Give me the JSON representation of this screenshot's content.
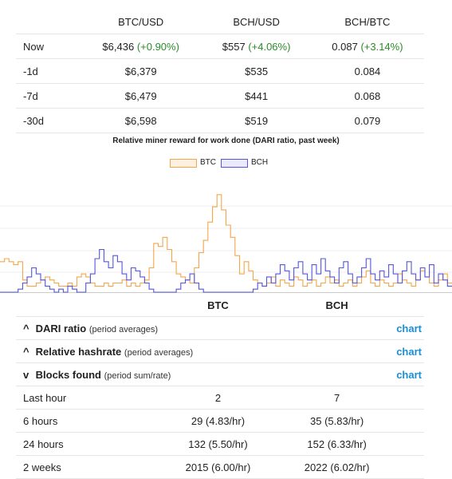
{
  "prices": {
    "columns": [
      "BTC/USD",
      "BCH/USD",
      "BCH/BTC"
    ],
    "rows": [
      {
        "label": "Now",
        "cells": [
          {
            "value": "$6,436",
            "change": "(+0.90%)"
          },
          {
            "value": "$557",
            "change": "(+4.06%)"
          },
          {
            "value": "0.087",
            "change": "(+3.14%)"
          }
        ]
      },
      {
        "label": "-1d",
        "cells": [
          {
            "value": "$6,379"
          },
          {
            "value": "$535"
          },
          {
            "value": "0.084"
          }
        ]
      },
      {
        "label": "-7d",
        "cells": [
          {
            "value": "$6,479"
          },
          {
            "value": "$441"
          },
          {
            "value": "0.068"
          }
        ]
      },
      {
        "label": "-30d",
        "cells": [
          {
            "value": "$6,598"
          },
          {
            "value": "$519"
          },
          {
            "value": "0.079"
          }
        ]
      }
    ]
  },
  "chart_data": {
    "type": "line",
    "title": "Relative miner reward for work done (DARI ratio, past week)",
    "legend_position": "top-center",
    "grid": true,
    "series": [
      {
        "name": "BTC",
        "color": "#f5a54a",
        "values": [
          1.0,
          1.1,
          1.0,
          0.9,
          1.0,
          0.4,
          0.2,
          0.2,
          0.3,
          0.4,
          0.5,
          0.4,
          0.3,
          0.2,
          0.2,
          0.3,
          0.2,
          0.5,
          0.6,
          0.5,
          0.3,
          0.2,
          0.2,
          0.3,
          0.2,
          0.3,
          0.3,
          0.4,
          0.2,
          0.3,
          0.2,
          0.3,
          0.4,
          0.8,
          1.6,
          1.5,
          1.8,
          1.4,
          1.0,
          0.6,
          0.5,
          0.4,
          0.3,
          0.8,
          1.3,
          1.7,
          2.3,
          2.8,
          3.2,
          2.7,
          2.2,
          1.8,
          1.2,
          0.6,
          1.0,
          0.7,
          0.4,
          0.3,
          0.2,
          0.3,
          0.5,
          0.2,
          0.4,
          0.3,
          0.2,
          0.5,
          0.4,
          0.2,
          0.3,
          0.4,
          0.2,
          0.3,
          0.5,
          0.3,
          0.4,
          0.2,
          0.3,
          0.4,
          0.2,
          0.3,
          0.5,
          0.7,
          0.3,
          0.2,
          0.4,
          0.3,
          0.2,
          0.3,
          0.6,
          0.4,
          0.3,
          0.2,
          0.4,
          0.7,
          0.5,
          0.3,
          0.2,
          0.4,
          0.6,
          0.3
        ]
      },
      {
        "name": "BCH",
        "color": "#5555dd",
        "values": [
          0.0,
          0.0,
          0.0,
          0.0,
          0.1,
          0.3,
          0.5,
          0.8,
          0.6,
          0.4,
          0.2,
          0.1,
          0.0,
          0.1,
          0.0,
          0.2,
          0.1,
          0.0,
          0.0,
          0.3,
          0.6,
          1.1,
          1.4,
          1.0,
          0.8,
          1.2,
          1.0,
          0.6,
          0.4,
          0.8,
          0.7,
          0.5,
          0.3,
          0.1,
          0.0,
          0.0,
          0.0,
          0.0,
          0.0,
          0.1,
          0.3,
          0.4,
          0.6,
          0.3,
          0.1,
          0.0,
          0.0,
          0.0,
          0.0,
          0.0,
          0.0,
          0.0,
          0.0,
          0.0,
          0.0,
          0.0,
          0.1,
          0.3,
          0.2,
          0.5,
          0.3,
          0.6,
          0.9,
          0.7,
          0.4,
          0.8,
          1.0,
          0.6,
          0.4,
          0.9,
          0.6,
          1.1,
          0.7,
          0.5,
          0.3,
          0.8,
          1.0,
          0.6,
          0.3,
          0.5,
          0.8,
          1.1,
          0.6,
          0.4,
          0.7,
          0.5,
          0.9,
          0.6,
          0.3,
          0.7,
          1.0,
          0.6,
          0.4,
          0.8,
          0.5,
          0.9,
          0.3,
          0.6,
          0.4,
          0.2
        ]
      }
    ]
  },
  "stats": {
    "headers": [
      "BTC",
      "BCH"
    ],
    "sections": [
      {
        "name": "DARI ratio",
        "note": "(period averages)",
        "link": "chart"
      },
      {
        "name": "Relative hashrate",
        "note": "(period averages)",
        "link": "chart"
      },
      {
        "name": "Blocks found",
        "note": "(period sum/rate)",
        "link": "chart"
      }
    ],
    "rows": [
      {
        "label": "Last hour",
        "btc": "2",
        "bch": "7"
      },
      {
        "label": "6 hours",
        "btc": "29 (4.83/hr)",
        "bch": "35 (5.83/hr)"
      },
      {
        "label": "24 hours",
        "btc": "132 (5.50/hr)",
        "bch": "152 (6.33/hr)"
      },
      {
        "label": "2 weeks",
        "btc": "2015 (6.00/hr)",
        "bch": "2022 (6.02/hr)"
      }
    ]
  }
}
